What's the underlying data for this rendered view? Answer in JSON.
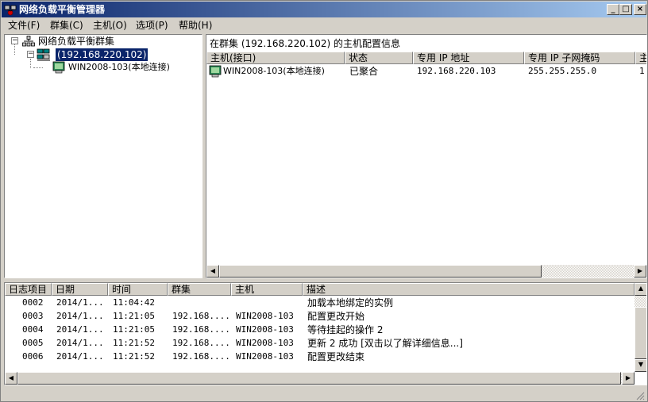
{
  "window": {
    "title": "网络负载平衡管理器",
    "controls": {
      "minimize": "_",
      "maximize": "□",
      "close": "×"
    }
  },
  "menu": [
    "文件(F)",
    "群集(C)",
    "主机(O)",
    "选项(P)",
    "帮助(H)"
  ],
  "tree": {
    "root": "网络负载平衡群集",
    "cluster": "(192.168.220.102)",
    "host": "WIN2008-103(本地连接)"
  },
  "hosts_panel": {
    "caption": "在群集  (192.168.220.102) 的主机配置信息",
    "columns": [
      "主机(接口)",
      "状态",
      "专用 IP 地址",
      "专用 IP 子网掩码",
      "主"
    ],
    "rows": [
      {
        "host": "WIN2008-103(本地连接)",
        "status": "已聚合",
        "ip": "192.168.220.103",
        "mask": "255.255.255.0",
        "priority": "1"
      }
    ]
  },
  "log": {
    "columns": [
      "日志项目",
      "日期",
      "时间",
      "群集",
      "主机",
      "描述"
    ],
    "rows": [
      {
        "id": "0002",
        "date": "2014/1...",
        "time": "11:04:42",
        "cluster": "",
        "host": "",
        "desc": "加载本地绑定的实例"
      },
      {
        "id": "0003",
        "date": "2014/1...",
        "time": "11:21:05",
        "cluster": "192.168....",
        "host": "WIN2008-103",
        "desc": "配置更改开始"
      },
      {
        "id": "0004",
        "date": "2014/1...",
        "time": "11:21:05",
        "cluster": "192.168....",
        "host": "WIN2008-103",
        "desc": "等待挂起的操作 2"
      },
      {
        "id": "0005",
        "date": "2014/1...",
        "time": "11:21:52",
        "cluster": "192.168....",
        "host": "WIN2008-103",
        "desc": "更新 2 成功 [双击以了解详细信息...]"
      },
      {
        "id": "0006",
        "date": "2014/1...",
        "time": "11:21:52",
        "cluster": "192.168....",
        "host": "WIN2008-103",
        "desc": "配置更改结束"
      }
    ]
  },
  "colors": {
    "titlebar_start": "#0a246a",
    "titlebar_end": "#a6caf0",
    "selection": "#0a246a",
    "chrome": "#d4d0c8"
  }
}
